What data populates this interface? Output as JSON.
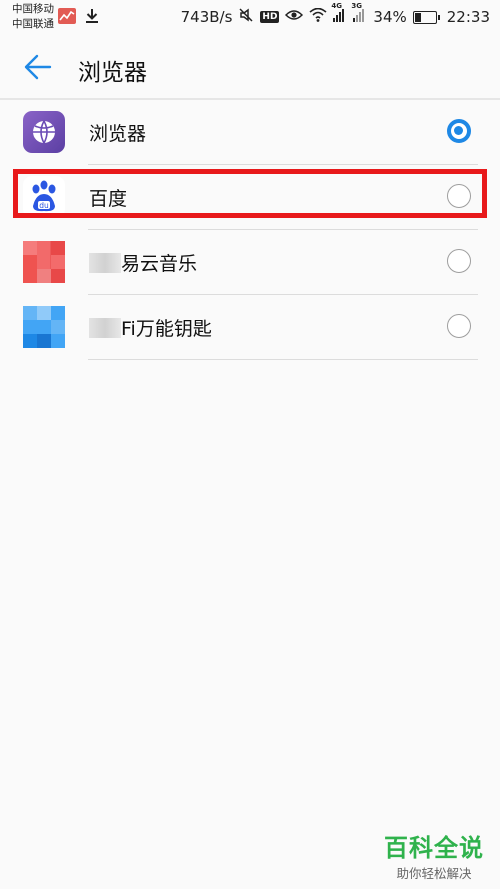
{
  "status_bar": {
    "carrier_1": "中国移动",
    "carrier_2": "中国联通",
    "net_speed": "743B/s",
    "hd_label": "HD",
    "signal_1_label": "4G",
    "signal_2_label": "3G",
    "battery_percent": "34%",
    "battery_level": 0.34,
    "time": "22:33"
  },
  "header": {
    "back_icon": "arrow-left-icon",
    "title": "浏览器",
    "accent_color": "#1e88e5"
  },
  "apps": [
    {
      "label": "浏览器",
      "icon": "browser-globe-icon",
      "selected": true
    },
    {
      "label": "百度",
      "icon": "baidu-paw-icon",
      "selected": false
    },
    {
      "label": "易云音乐",
      "icon": "music-app-icon",
      "selected": false
    },
    {
      "label": "Fi万能钥匙",
      "icon": "wifi-key-app-icon",
      "selected": false
    }
  ],
  "watermark": {
    "title": "百科全说",
    "subtitle": "助你轻松解决"
  }
}
